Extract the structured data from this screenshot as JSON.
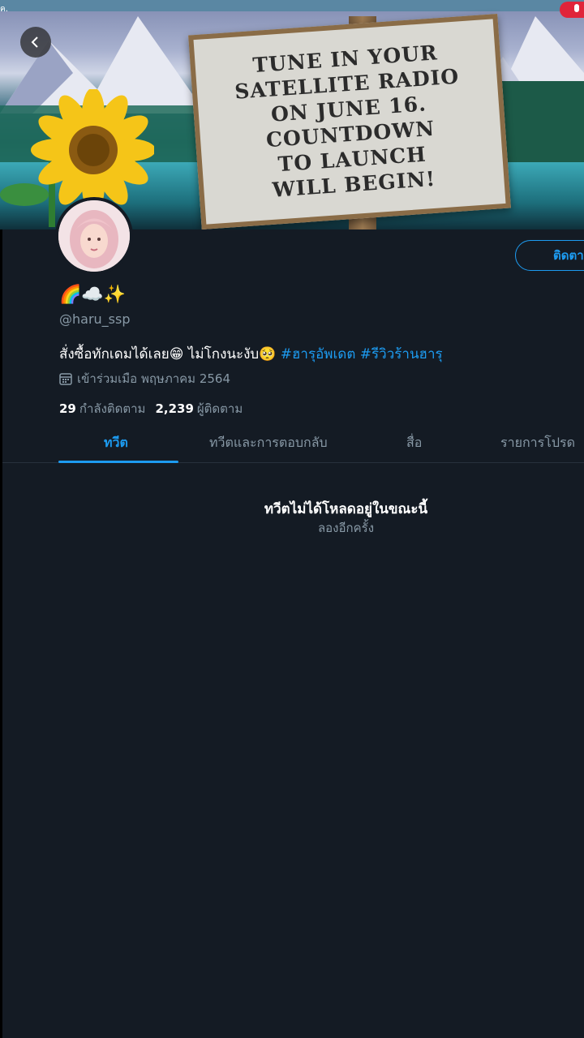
{
  "banner": {
    "sign_text": "TUNE IN YOUR\nSATELLITE RADIO\nON JUNE 16.\nCOUNTDOWN\nTO LAUNCH\nWILL BEGIN!"
  },
  "status": {
    "left_text": "ค."
  },
  "profile": {
    "display_name": "🌈☁️✨",
    "handle": "@haru_ssp",
    "bio_text": "สั่งซื้อทักเดมได้เลย😁 ไม่โกงนะงับ🥺 ",
    "bio_tags": [
      "#ฮารุอัพเดต",
      "#รีวิวร้านฮารุ"
    ],
    "joined": "เข้าร่วมเมือ พฤษภาคม 2564",
    "following_count": "29",
    "following_label": "กำลังติดตาม",
    "followers_count": "2,239",
    "followers_label": "ผู้ติดตาม",
    "follow_button": "ติดตา"
  },
  "tabs": [
    {
      "label": "ทวีต",
      "active": true
    },
    {
      "label": "ทวีตและการตอบกลับ",
      "active": false
    },
    {
      "label": "สื่อ",
      "active": false
    },
    {
      "label": "รายการโปรด",
      "active": false
    }
  ],
  "feed": {
    "empty_title": "ทวีตไม่ได้โหลดอยู่ในขณะนี้",
    "empty_subtitle": "ลองอีกครั้ง"
  },
  "colors": {
    "accent": "#1d9bf0",
    "background": "#141b24",
    "muted": "#8899a6"
  },
  "icons": [
    "back-arrow-icon",
    "calendar-icon",
    "mic-icon"
  ]
}
